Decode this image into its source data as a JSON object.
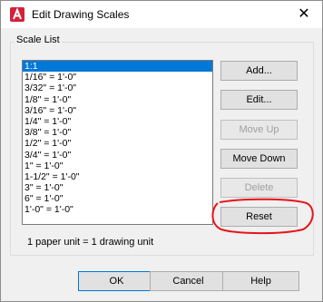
{
  "window": {
    "title": "Edit Drawing Scales"
  },
  "icons": {
    "app": "autocad-a-icon",
    "close": "close-icon"
  },
  "close_glyph": "✕",
  "group": {
    "label": "Scale List"
  },
  "scales": [
    {
      "label": "1:1",
      "selected": true
    },
    {
      "label": "1/16\" = 1'-0\""
    },
    {
      "label": "3/32\" = 1'-0\""
    },
    {
      "label": "1/8\" = 1'-0\""
    },
    {
      "label": "3/16\" = 1'-0\""
    },
    {
      "label": "1/4\" = 1'-0\""
    },
    {
      "label": "3/8\" = 1'-0\""
    },
    {
      "label": "1/2\" = 1'-0\""
    },
    {
      "label": "3/4\" = 1'-0\""
    },
    {
      "label": "1\" = 1'-0\""
    },
    {
      "label": "1-1/2\" = 1'-0\""
    },
    {
      "label": "3\" = 1'-0\""
    },
    {
      "label": "6\" = 1'-0\""
    },
    {
      "label": "1'-0\" = 1'-0\""
    }
  ],
  "side_buttons": {
    "add": "Add...",
    "edit": "Edit...",
    "move_up": "Move Up",
    "move_down": "Move Down",
    "delete": "Delete",
    "reset": "Reset"
  },
  "info_text": "1 paper unit = 1 drawing unit",
  "footer": {
    "ok": "OK",
    "cancel": "Cancel",
    "help": "Help"
  },
  "colors": {
    "selection": "#0078d7",
    "annotation": "#e8131b",
    "app_icon": "#d4213a"
  }
}
